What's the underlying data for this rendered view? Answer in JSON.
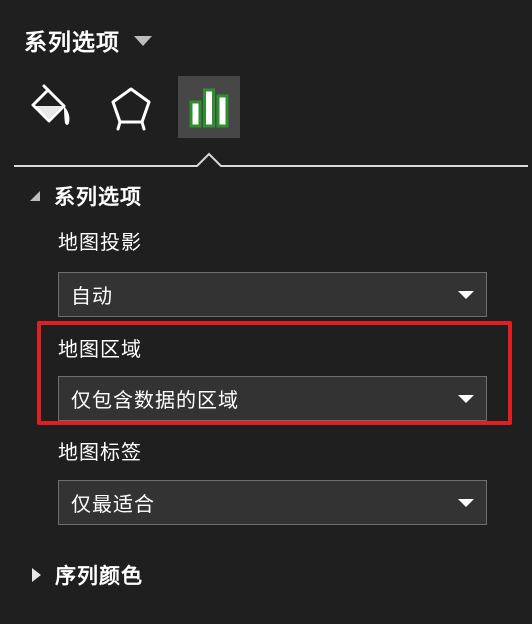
{
  "pane": {
    "title": "系列选项"
  },
  "tabs": [
    {
      "id": "fill-line",
      "icon": "paint-bucket-icon",
      "selected": false
    },
    {
      "id": "effects",
      "icon": "pentagon-icon",
      "selected": false
    },
    {
      "id": "series-options",
      "icon": "bar-chart-icon",
      "selected": true
    }
  ],
  "sections": {
    "series_options": {
      "label": "系列选项",
      "expanded": true,
      "fields": {
        "map_projection": {
          "label": "地图投影",
          "value": "自动"
        },
        "map_area": {
          "label": "地图区域",
          "value": "仅包含数据的区域"
        },
        "map_labels": {
          "label": "地图标签",
          "value": "仅最适合"
        }
      }
    },
    "series_color": {
      "label": "序列颜色",
      "expanded": false
    }
  },
  "colors": {
    "background": "#1f1f1f",
    "selected_tab": "#474747",
    "chart_icon_green": "#2f8f2f",
    "highlight_red": "#e02020",
    "dropdown_bg": "#333333",
    "dropdown_border": "#6e6e6e"
  }
}
